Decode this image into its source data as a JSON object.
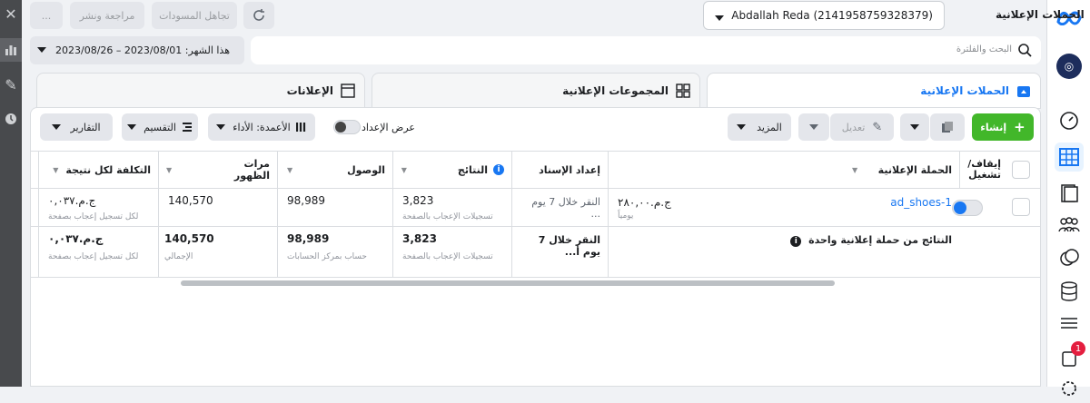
{
  "header": {
    "title": "الحملات الإعلانية",
    "account": "Abdallah Reda (2141958759328379)",
    "review_publish": "مراجعة ونشر",
    "discard_drafts": "تجاهل المسودات",
    "more": "..."
  },
  "toolbar": {
    "date_range": "هذا الشهر: 2023/08/01 – 2023/08/26",
    "search_placeholder": "البحث والفلترة"
  },
  "tabs": {
    "campaigns": "الحملات الإعلانية",
    "adsets": "المجموعات الإعلانية",
    "ads": "الإعلانات"
  },
  "actions": {
    "create": "إنشاء",
    "edit": "تعديل",
    "more": "المزيد",
    "setup_view": "عرض الإعداد",
    "columns": "الأعمدة: الأداء",
    "breakdown": "التقسيم",
    "reports": "التقارير"
  },
  "table": {
    "headers": {
      "toggle": "إيقاف/ تشغيل",
      "campaign": "الحملة الإعلانية",
      "attribution": "إعداد الإسناد",
      "results": "النتائج",
      "reach": "الوصول",
      "impressions": "مرات الظهور",
      "cost": "التكلفة لكل نتيجة"
    },
    "row": {
      "name": "ad_shoes-1",
      "budget": "ج.م.٢٨٠,٠٠",
      "budget_sub": "يومياً",
      "attribution": "النقر خلال 7 يوم ...",
      "results": "3,823",
      "results_sub": "تسجيلات الإعجاب بالصفحة",
      "reach": "98,989",
      "impressions": "140,570",
      "cost": "ج.م.٠,٠٣٧",
      "cost_sub": "لكل تسجيل إعجاب بصفحة"
    },
    "summary": {
      "label": "النتائج من حملة إعلانية واحدة",
      "attribution": "النقر خلال 7 يوم أ...",
      "results": "3,823",
      "results_sub": "تسجيلات الإعجاب بالصفحة",
      "reach": "98,989",
      "reach_sub": "حساب بمركز الحسابات",
      "impressions": "140,570",
      "impressions_sub": "الإجمالي",
      "cost": "ج.م.٠,٠٣٧",
      "cost_sub": "لكل تسجيل إعجاب بصفحة"
    }
  },
  "notifications": {
    "badge": "1"
  },
  "colors": {
    "accent": "#1877f2",
    "green": "#42b72a"
  }
}
